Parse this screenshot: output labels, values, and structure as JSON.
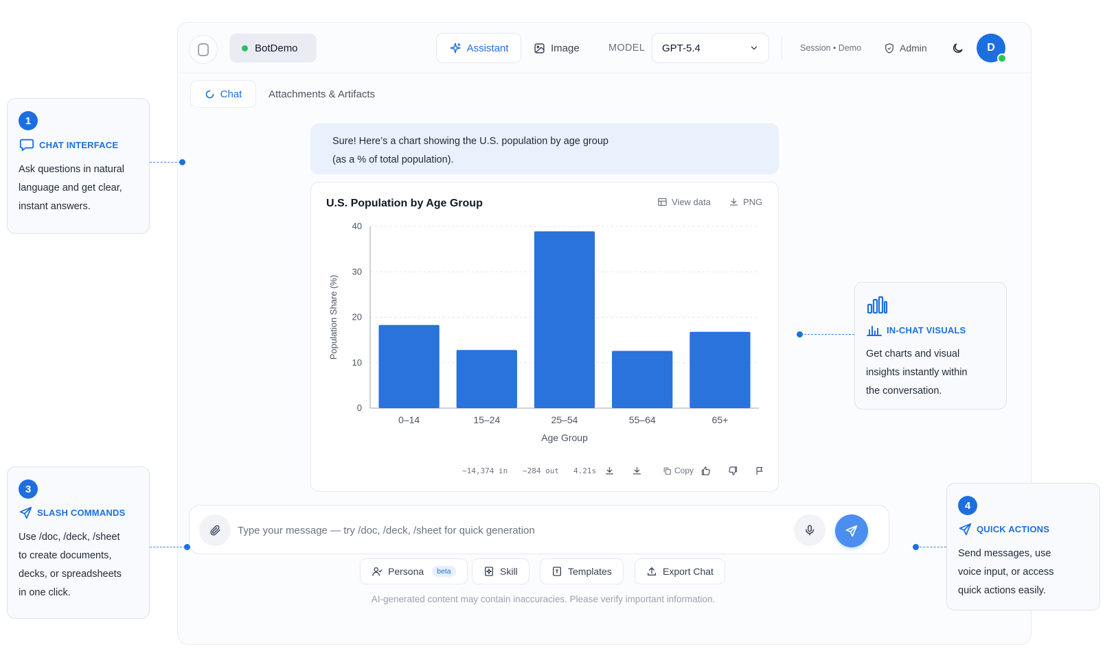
{
  "header": {
    "brand": "BotDemo",
    "tab_assistant": "Assistant",
    "tab_image": "Image",
    "model_label": "MODEL",
    "model_value": "GPT-5.4",
    "session": "Session • Demo",
    "admin": "Admin",
    "avatar_initial": "D"
  },
  "subtabs": {
    "chat": "Chat",
    "attachments": "Attachments & Artifacts"
  },
  "message": {
    "line1": "Sure! Here’s a chart showing the U.S. population by age group",
    "line2": "(as a % of total population)."
  },
  "chart_card": {
    "title": "U.S. Population by Age Group",
    "view_data": "View data",
    "png": "PNG",
    "tokens_in": "~14,374 in",
    "tokens_out": "~284 out",
    "latency": "4.21s",
    "copy": "Copy"
  },
  "chart_data": {
    "type": "bar",
    "title": "U.S. Population by Age Group",
    "categories": [
      "0–14",
      "15–24",
      "25–54",
      "55–64",
      "65+"
    ],
    "values": [
      18.3,
      12.8,
      38.9,
      12.6,
      16.8
    ],
    "xlabel": "Age Group",
    "ylabel": "Population Share (%)",
    "ylim": [
      0,
      40
    ],
    "yticks": [
      0,
      10,
      20,
      30,
      40
    ],
    "grid": true,
    "bar_color": "#2a72dc"
  },
  "composer": {
    "placeholder": "Type your message — try /doc, /deck, /sheet for quick generation"
  },
  "quick_actions": {
    "persona": "Persona",
    "beta": "beta",
    "skill": "Skill",
    "templates": "Templates",
    "export": "Export Chat"
  },
  "disclaimer": "AI-generated content may contain inaccuracies. Please verify important information.",
  "callouts": {
    "c1": {
      "num": "1",
      "title": "CHAT INTERFACE",
      "l1": "Ask questions in natural",
      "l2": "language and get clear,",
      "l3": "instant answers."
    },
    "c2": {
      "title": "IN-CHAT VISUALS",
      "l1": "Get charts and visual",
      "l2": "insights instantly within",
      "l3": "the conversation."
    },
    "c3": {
      "num": "3",
      "title": "SLASH COMMANDS",
      "l1": "Use /doc, /deck, /sheet",
      "l2": "to create documents,",
      "l3": "decks, or spreadsheets",
      "l4": "in one click."
    },
    "c4": {
      "num": "4",
      "title": "QUICK ACTIONS",
      "l1": "Send messages, use",
      "l2": "voice input, or access",
      "l3": "quick actions easily."
    }
  },
  "colors": {
    "accent": "#1d6fe0",
    "online": "#22c55e",
    "bubble": "#e9f1fc"
  }
}
